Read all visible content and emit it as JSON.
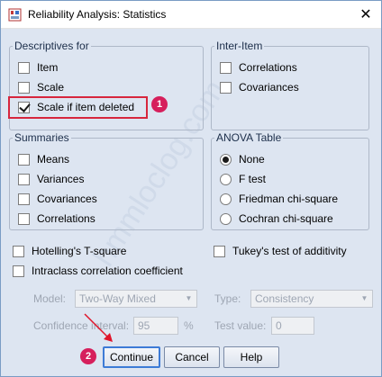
{
  "window": {
    "title": "Reliability Analysis: Statistics"
  },
  "descriptives": {
    "legend": "Descriptives for",
    "items": [
      {
        "label": "Item",
        "checked": false
      },
      {
        "label": "Scale",
        "checked": false
      },
      {
        "label": "Scale if item deleted",
        "checked": true
      }
    ]
  },
  "inter_item": {
    "legend": "Inter-Item",
    "items": [
      {
        "label": "Correlations",
        "checked": false
      },
      {
        "label": "Covariances",
        "checked": false
      }
    ]
  },
  "summaries": {
    "legend": "Summaries",
    "items": [
      {
        "label": "Means",
        "checked": false
      },
      {
        "label": "Variances",
        "checked": false
      },
      {
        "label": "Covariances",
        "checked": false
      },
      {
        "label": "Correlations",
        "checked": false
      }
    ]
  },
  "anova": {
    "legend": "ANOVA Table",
    "options": [
      {
        "label": "None",
        "selected": true
      },
      {
        "label": "F test",
        "selected": false
      },
      {
        "label": "Friedman chi-square",
        "selected": false
      },
      {
        "label": "Cochran chi-square",
        "selected": false
      }
    ]
  },
  "extra": {
    "hotelling": "Hotelling's T-square",
    "tukey": "Tukey's test of additivity",
    "intraclass": "Intraclass correlation coefficient"
  },
  "icc": {
    "model_label": "Model:",
    "model_value": "Two-Way Mixed",
    "type_label": "Type:",
    "type_value": "Consistency",
    "ci_label": "Confidence interval:",
    "ci_value": "95",
    "ci_unit": "%",
    "test_label": "Test value:",
    "test_value": "0"
  },
  "buttons": {
    "continue": "Continue",
    "cancel": "Cancel",
    "help": "Help"
  },
  "annotations": {
    "badge1": "1",
    "badge2": "2"
  },
  "watermark": "hmmloclog.com",
  "colors": {
    "client_bg": "#dde5f1",
    "highlight": "#d7263d",
    "badge": "#d61f5c",
    "default_button_border": "#3d7bd6"
  }
}
